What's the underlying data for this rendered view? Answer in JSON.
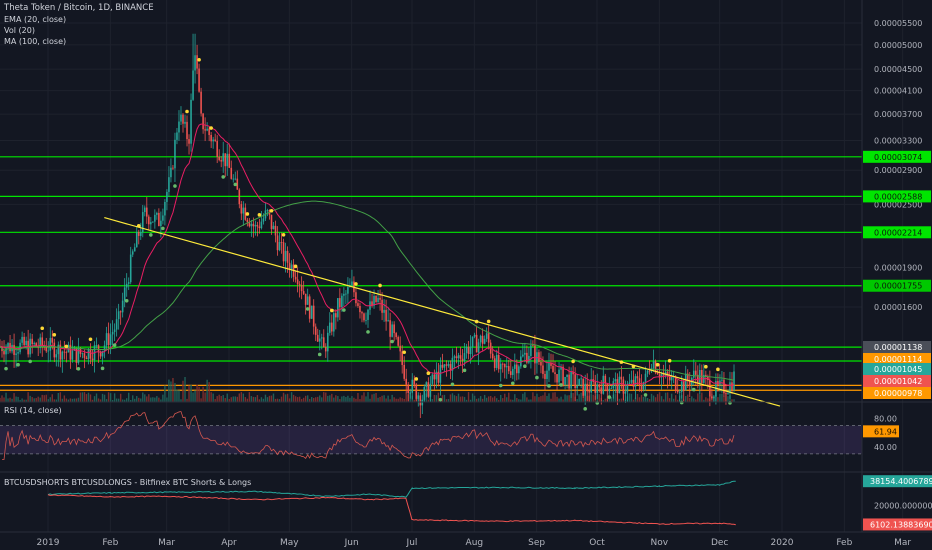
{
  "header": {
    "title": "Theta Token / Bitcoin, 1D, BINANCE",
    "studies": [
      "EMA (20, close)",
      "Vol (20)",
      "MA (100, close)"
    ]
  },
  "rsi_panel": {
    "label": "RSI (14, close)",
    "ticks": [
      "80.00",
      "40.00"
    ],
    "current_value": "61.94"
  },
  "shorts_longs_panel": {
    "label": "BTCUSDSHORTS BTCUSDLONGS - Bitfinex BTC Shorts & Longs",
    "tick": "20000.00000000",
    "longs_value": "38154.40067895",
    "shorts_value": "6102.13883690"
  },
  "colors": {
    "background": "#131722",
    "up": "#26a69a",
    "down": "#ef5350",
    "ema": "#e91e63",
    "ma100": "#43a047",
    "trendline": "#ffeb3b",
    "level_green": "#00e600",
    "level_orange": "#ff9800",
    "rsi_band": "#7e57c2"
  },
  "chart_data": [
    {
      "type": "candlestick",
      "title": "Theta Token / Bitcoin, 1D, BINANCE",
      "x_ticks": [
        "2019",
        "Feb",
        "Mar",
        "Apr",
        "May",
        "Jun",
        "Jul",
        "Aug",
        "Sep",
        "Oct",
        "Nov",
        "Dec",
        "2020",
        "Feb",
        "Mar"
      ],
      "y_ticks": [
        "0.00005500",
        "0.00005000",
        "0.00004500",
        "0.00004100",
        "0.00003700",
        "0.00003300",
        "0.00002900",
        "0.00002500",
        "0.00001900",
        "0.00001600"
      ],
      "ylim": [
        8.5e-06,
        5.65e-05
      ],
      "level_lines": [
        {
          "value": "0.00003074",
          "color": "green"
        },
        {
          "value": "0.00002588",
          "color": "green"
        },
        {
          "value": "0.00002214",
          "color": "green"
        },
        {
          "value": "0.00001755",
          "color": "green"
        },
        {
          "value": "0.00001344",
          "color": "green"
        },
        {
          "value": "0.00001265",
          "color": "green"
        },
        {
          "value": "0.00001138",
          "color": "orange"
        },
        {
          "value": "0.00001114",
          "color": "orange"
        }
      ],
      "price_labels": [
        {
          "value": "0.00001138",
          "color": "gray"
        },
        {
          "value": "0.00001114",
          "color": "orange"
        },
        {
          "value": "0.00001045",
          "color": "green"
        },
        {
          "value": "0.00001042",
          "color": "red"
        },
        {
          "value": "0.00000978",
          "color": "orange"
        }
      ],
      "trendline": {
        "start": [
          "2019-01-29",
          2.36e-05
        ],
        "end": [
          "2019-12-31",
          1.04e-05
        ]
      },
      "close_keypoints": [
        [
          "2019-01-01",
          1.35e-05
        ],
        [
          "2019-01-15",
          1.3e-05
        ],
        [
          "2019-01-28",
          1.34e-05
        ],
        [
          "2019-02-05",
          1.5e-05
        ],
        [
          "2019-02-12",
          2e-05
        ],
        [
          "2019-02-18",
          2.4e-05
        ],
        [
          "2019-02-25",
          2.32e-05
        ],
        [
          "2019-03-03",
          2.8e-05
        ],
        [
          "2019-03-07",
          3.7e-05
        ],
        [
          "2019-03-12",
          3.3e-05
        ],
        [
          "2019-03-15",
          5e-05
        ],
        [
          "2019-03-18",
          3.6e-05
        ],
        [
          "2019-03-24",
          3.3e-05
        ],
        [
          "2019-03-31",
          3e-05
        ],
        [
          "2019-04-07",
          2.5e-05
        ],
        [
          "2019-04-14",
          2.25e-05
        ],
        [
          "2019-04-20",
          2.4e-05
        ],
        [
          "2019-04-28",
          2e-05
        ],
        [
          "2019-05-05",
          1.85e-05
        ],
        [
          "2019-05-12",
          1.55e-05
        ],
        [
          "2019-05-18",
          1.32e-05
        ],
        [
          "2019-05-25",
          1.6e-05
        ],
        [
          "2019-06-01",
          1.75e-05
        ],
        [
          "2019-06-07",
          1.55e-05
        ],
        [
          "2019-06-14",
          1.65e-05
        ],
        [
          "2019-06-22",
          1.4e-05
        ],
        [
          "2019-06-29",
          1.15e-05
        ],
        [
          "2019-07-06",
          1.08e-05
        ],
        [
          "2019-07-13",
          1.18e-05
        ],
        [
          "2019-07-20",
          1.25e-05
        ],
        [
          "2019-07-30",
          1.35e-05
        ],
        [
          "2019-08-07",
          1.4e-05
        ],
        [
          "2019-08-14",
          1.2e-05
        ],
        [
          "2019-08-22",
          1.25e-05
        ],
        [
          "2019-08-29",
          1.33e-05
        ],
        [
          "2019-09-05",
          1.22e-05
        ],
        [
          "2019-09-15",
          1.18e-05
        ],
        [
          "2019-09-25",
          1.12e-05
        ],
        [
          "2019-10-05",
          1.15e-05
        ],
        [
          "2019-10-15",
          1.13e-05
        ],
        [
          "2019-10-25",
          1.16e-05
        ],
        [
          "2019-10-28",
          1.28e-05
        ],
        [
          "2019-11-03",
          1.18e-05
        ],
        [
          "2019-11-12",
          1.14e-05
        ],
        [
          "2019-11-20",
          1.2e-05
        ],
        [
          "2019-11-28",
          1.11e-05
        ],
        [
          "2019-12-06",
          1.14e-05
        ],
        [
          "2019-12-09",
          1.2e-05
        ]
      ]
    },
    {
      "type": "line",
      "title": "RSI (14, close)",
      "ylim": [
        10,
        95
      ],
      "band": [
        30,
        70
      ],
      "last_value": 61.94
    },
    {
      "type": "line",
      "title": "BTCUSDSHORTS BTCUSDLONGS - Bitfinex BTC Shorts & Longs",
      "series": [
        {
          "name": "BTCUSDLONGS",
          "color": "#26a69a",
          "points": [
            [
              "2019-01-01",
              28500
            ],
            [
              "2019-02-01",
              29500
            ],
            [
              "2019-03-01",
              30000
            ],
            [
              "2019-04-15",
              30500
            ],
            [
              "2019-05-20",
              27000
            ],
            [
              "2019-06-10",
              28500
            ],
            [
              "2019-06-28",
              26500
            ],
            [
              "2019-07-01",
              33000
            ],
            [
              "2019-08-15",
              33500
            ],
            [
              "2019-09-20",
              33000
            ],
            [
              "2019-11-01",
              34500
            ],
            [
              "2019-12-01",
              35500
            ],
            [
              "2019-12-09",
              38154.40067895
            ]
          ]
        },
        {
          "name": "BTCUSDSHORTS",
          "color": "#ef5350",
          "points": [
            [
              "2019-01-01",
              28000
            ],
            [
              "2019-02-01",
              26500
            ],
            [
              "2019-03-01",
              27000
            ],
            [
              "2019-04-15",
              24500
            ],
            [
              "2019-05-20",
              26000
            ],
            [
              "2019-06-10",
              24500
            ],
            [
              "2019-06-28",
              25500
            ],
            [
              "2019-07-01",
              9500
            ],
            [
              "2019-08-15",
              8500
            ],
            [
              "2019-09-20",
              9000
            ],
            [
              "2019-11-01",
              6500
            ],
            [
              "2019-12-01",
              7000
            ],
            [
              "2019-12-09",
              6102.1388369
            ]
          ]
        }
      ],
      "ylim": [
        2000,
        42000
      ]
    }
  ]
}
